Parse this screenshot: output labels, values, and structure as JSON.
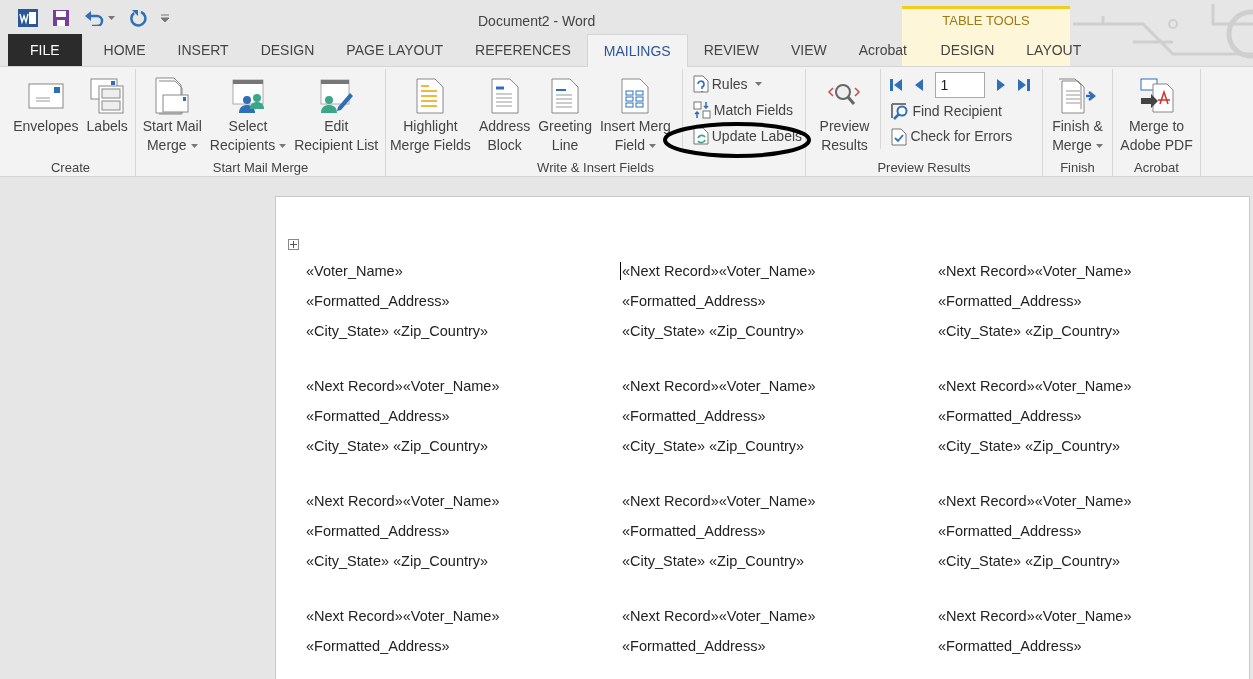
{
  "window": {
    "title": "Document2 - Word"
  },
  "tabs": [
    {
      "label": "FILE",
      "kind": "file",
      "selected": false
    },
    {
      "label": "HOME",
      "kind": "tab",
      "selected": false
    },
    {
      "label": "INSERT",
      "kind": "tab",
      "selected": false
    },
    {
      "label": "DESIGN",
      "kind": "tab",
      "selected": false
    },
    {
      "label": "PAGE LAYOUT",
      "kind": "tab",
      "selected": false
    },
    {
      "label": "REFERENCES",
      "kind": "tab",
      "selected": false
    },
    {
      "label": "MAILINGS",
      "kind": "tab",
      "selected": true
    },
    {
      "label": "REVIEW",
      "kind": "tab",
      "selected": false
    },
    {
      "label": "VIEW",
      "kind": "tab",
      "selected": false
    },
    {
      "label": "Acrobat",
      "kind": "tab",
      "selected": false
    }
  ],
  "contextual_tabs": {
    "title": "TABLE TOOLS",
    "tabs": [
      {
        "label": "DESIGN",
        "selected": false
      },
      {
        "label": "LAYOUT",
        "selected": false
      }
    ]
  },
  "ribbon": {
    "groups": [
      {
        "label": "Create",
        "buttons": [
          {
            "kind": "large",
            "lines": [
              "Envelopes"
            ],
            "dropdown": false
          },
          {
            "kind": "large",
            "lines": [
              "Labels"
            ],
            "dropdown": false
          }
        ]
      },
      {
        "label": "Start Mail Merge",
        "buttons": [
          {
            "kind": "large",
            "lines": [
              "Start Mail",
              "Merge"
            ],
            "dropdown": true
          },
          {
            "kind": "large",
            "lines": [
              "Select",
              "Recipients"
            ],
            "dropdown": true
          },
          {
            "kind": "large",
            "lines": [
              "Edit",
              "Recipient List"
            ],
            "dropdown": false
          }
        ]
      },
      {
        "label": "Write & Insert Fields",
        "buttons": [
          {
            "kind": "large",
            "lines": [
              "Highlight",
              "Merge Fields"
            ],
            "dropdown": false
          },
          {
            "kind": "large",
            "lines": [
              "Address",
              "Block"
            ],
            "dropdown": false
          },
          {
            "kind": "large",
            "lines": [
              "Greeting",
              "Line"
            ],
            "dropdown": false
          },
          {
            "kind": "large",
            "lines": [
              "Insert Merg",
              "Field"
            ],
            "dropdown": true
          },
          {
            "kind": "small",
            "label": "Rules",
            "dropdown": true
          },
          {
            "kind": "small",
            "label": "Match Fields",
            "dropdown": false
          },
          {
            "kind": "small",
            "label": "Update Labels",
            "dropdown": false
          }
        ]
      },
      {
        "label": "Preview Results",
        "buttons": [
          {
            "kind": "large",
            "lines": [
              "Preview",
              "Results"
            ],
            "dropdown": false
          },
          {
            "kind": "record_nav",
            "value": "1"
          },
          {
            "kind": "small",
            "label": "Find Recipient",
            "dropdown": false
          },
          {
            "kind": "small",
            "label": "Check for Errors",
            "dropdown": false
          }
        ]
      },
      {
        "label": "Finish",
        "buttons": [
          {
            "kind": "large",
            "lines": [
              "Finish &",
              "Merge"
            ],
            "dropdown": true
          }
        ]
      },
      {
        "label": "Acrobat",
        "buttons": [
          {
            "kind": "large",
            "lines": [
              "Merge to",
              "Adobe PDF"
            ],
            "dropdown": false
          }
        ]
      }
    ]
  },
  "document": {
    "label_rows": [
      {
        "cells": [
          {
            "has_cursor": false,
            "lines": [
              "«Voter_Name»",
              "«Formatted_Address»",
              "«City_State» «Zip_Country»"
            ]
          },
          {
            "has_cursor": true,
            "lines": [
              "«Next Record»«Voter_Name»",
              "«Formatted_Address»",
              "«City_State» «Zip_Country»"
            ]
          },
          {
            "has_cursor": false,
            "lines": [
              "«Next Record»«Voter_Name»",
              "«Formatted_Address»",
              "«City_State» «Zip_Country»"
            ]
          }
        ]
      },
      {
        "cells": [
          {
            "has_cursor": false,
            "lines": [
              "«Next Record»«Voter_Name»",
              "«Formatted_Address»",
              "«City_State» «Zip_Country»"
            ]
          },
          {
            "has_cursor": false,
            "lines": [
              "«Next Record»«Voter_Name»",
              "«Formatted_Address»",
              "«City_State» «Zip_Country»"
            ]
          },
          {
            "has_cursor": false,
            "lines": [
              "«Next Record»«Voter_Name»",
              "«Formatted_Address»",
              "«City_State» «Zip_Country»"
            ]
          }
        ]
      },
      {
        "cells": [
          {
            "has_cursor": false,
            "lines": [
              "«Next Record»«Voter_Name»",
              "«Formatted_Address»",
              "«City_State» «Zip_Country»"
            ]
          },
          {
            "has_cursor": false,
            "lines": [
              "«Next Record»«Voter_Name»",
              "«Formatted_Address»",
              "«City_State» «Zip_Country»"
            ]
          },
          {
            "has_cursor": false,
            "lines": [
              "«Next Record»«Voter_Name»",
              "«Formatted_Address»",
              "«City_State» «Zip_Country»"
            ]
          }
        ]
      },
      {
        "cells": [
          {
            "has_cursor": false,
            "lines": [
              "«Next Record»«Voter_Name»",
              "«Formatted_Address»"
            ]
          },
          {
            "has_cursor": false,
            "lines": [
              "«Next Record»«Voter_Name»",
              "«Formatted_Address»"
            ]
          },
          {
            "has_cursor": false,
            "lines": [
              "«Next Record»«Voter_Name»",
              "«Formatted_Address»"
            ]
          }
        ]
      }
    ]
  }
}
